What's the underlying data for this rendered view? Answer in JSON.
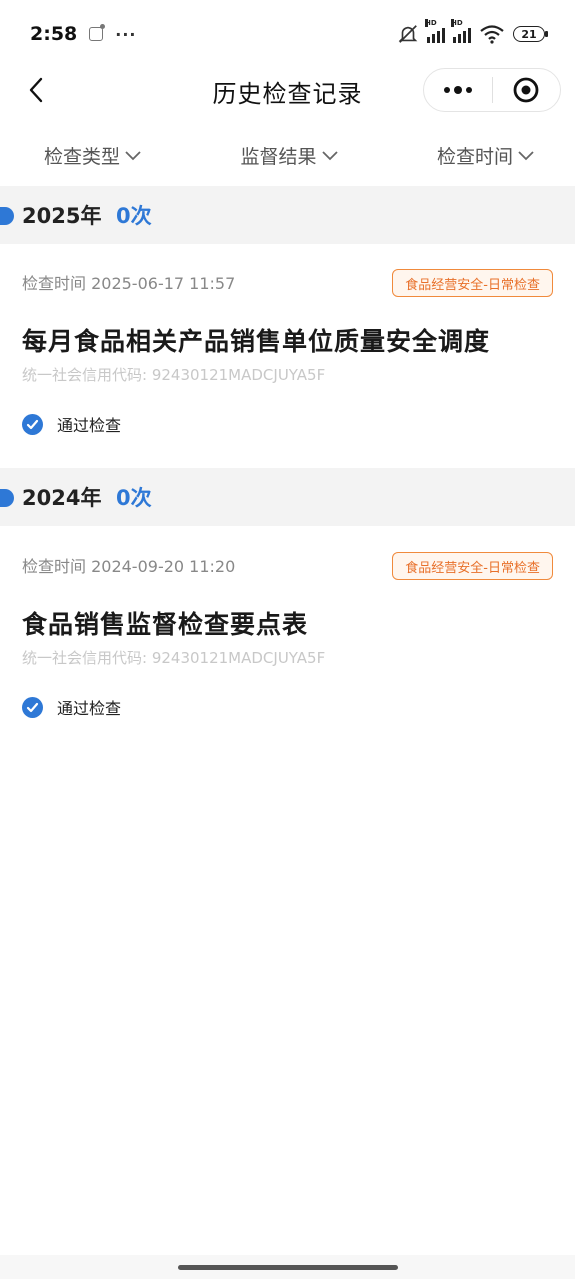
{
  "status_bar": {
    "time": "2:58",
    "dots": "···",
    "battery": "21"
  },
  "nav": {
    "title": "历史检查记录"
  },
  "filters": [
    {
      "label": "检查类型"
    },
    {
      "label": "监督结果"
    },
    {
      "label": "检查时间"
    }
  ],
  "groups": [
    {
      "year": "2025年",
      "count": "0次",
      "records": [
        {
          "time": "检查时间 2025-06-17 11:57",
          "tag": "食品经营安全-日常检查",
          "title": "每月食品相关产品销售单位质量安全调度",
          "code": "统一社会信用代码: 92430121MADCJUYA5F",
          "result": "通过检查"
        }
      ]
    },
    {
      "year": "2024年",
      "count": "0次",
      "records": [
        {
          "time": "检查时间 2024-09-20 11:20",
          "tag": "食品经营安全-日常检查",
          "title": "食品销售监督检查要点表",
          "code": "统一社会信用代码: 92430121MADCJUYA5F",
          "result": "通过检查"
        }
      ]
    }
  ],
  "colors": {
    "accent": "#2e78d6",
    "tag": "#e8702a",
    "section_bg": "#f3f3f3"
  }
}
